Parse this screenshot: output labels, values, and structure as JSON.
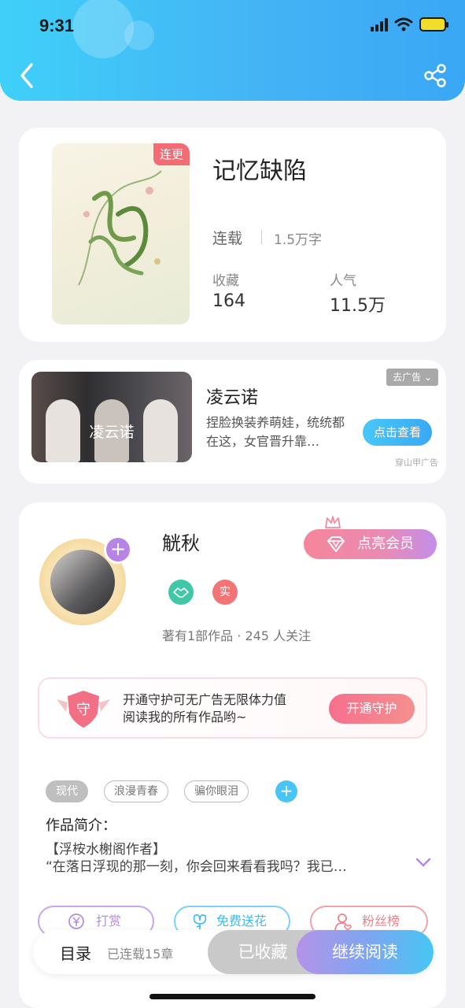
{
  "status_bar": {
    "time": "9:31"
  },
  "book": {
    "title": "记忆缺陷",
    "cover_badge": "连更",
    "status": "连载",
    "words": "1.5万字",
    "stats": [
      {
        "label": "收藏",
        "value": "164"
      },
      {
        "label": "人气",
        "value": "11.5万"
      }
    ]
  },
  "ad": {
    "image_label": "凌云诺",
    "title": "凌云诺",
    "description": "捏脸换装养萌娃，统统都在这，女官晋升靠…",
    "remove_label": "去广告",
    "cta_label": "点击查看",
    "source": "穿山甲广告"
  },
  "author": {
    "name": "觥秋",
    "vip_label": "点亮会员",
    "badge_2": "实",
    "meta": "著有1部作品 · 245 人关注",
    "guard": {
      "text_line1": "开通守护可无广告无限体力值",
      "text_line2": "阅读我的所有作品哟~",
      "shield_char": "守",
      "button_label": "开通守护"
    }
  },
  "tags": [
    "现代",
    "浪漫青春",
    "骗你眼泪"
  ],
  "intro": {
    "label": "作品简介：",
    "line1": "【浮桉水榭阁作者】",
    "line2": "“在落日浮现的那一刻，你会回来看看我吗？我已…"
  },
  "actions": [
    {
      "label": "打赏",
      "icon": "yen-icon",
      "color": "#b48ee6"
    },
    {
      "label": "免费送花",
      "icon": "flower-icon",
      "color": "#48c4f5"
    },
    {
      "label": "粉丝榜",
      "icon": "fans-icon",
      "color": "#f0828c"
    }
  ],
  "bottom_bar": {
    "toc_label": "目录",
    "toc_count": "已连载15章",
    "favorited_label": "已收藏",
    "read_label": "继续阅读"
  },
  "colors": {
    "header": "#3fc0f7",
    "accent_blue": "#48c4f5",
    "accent_pink": "#f66f8d",
    "accent_purple": "#b784e6"
  }
}
